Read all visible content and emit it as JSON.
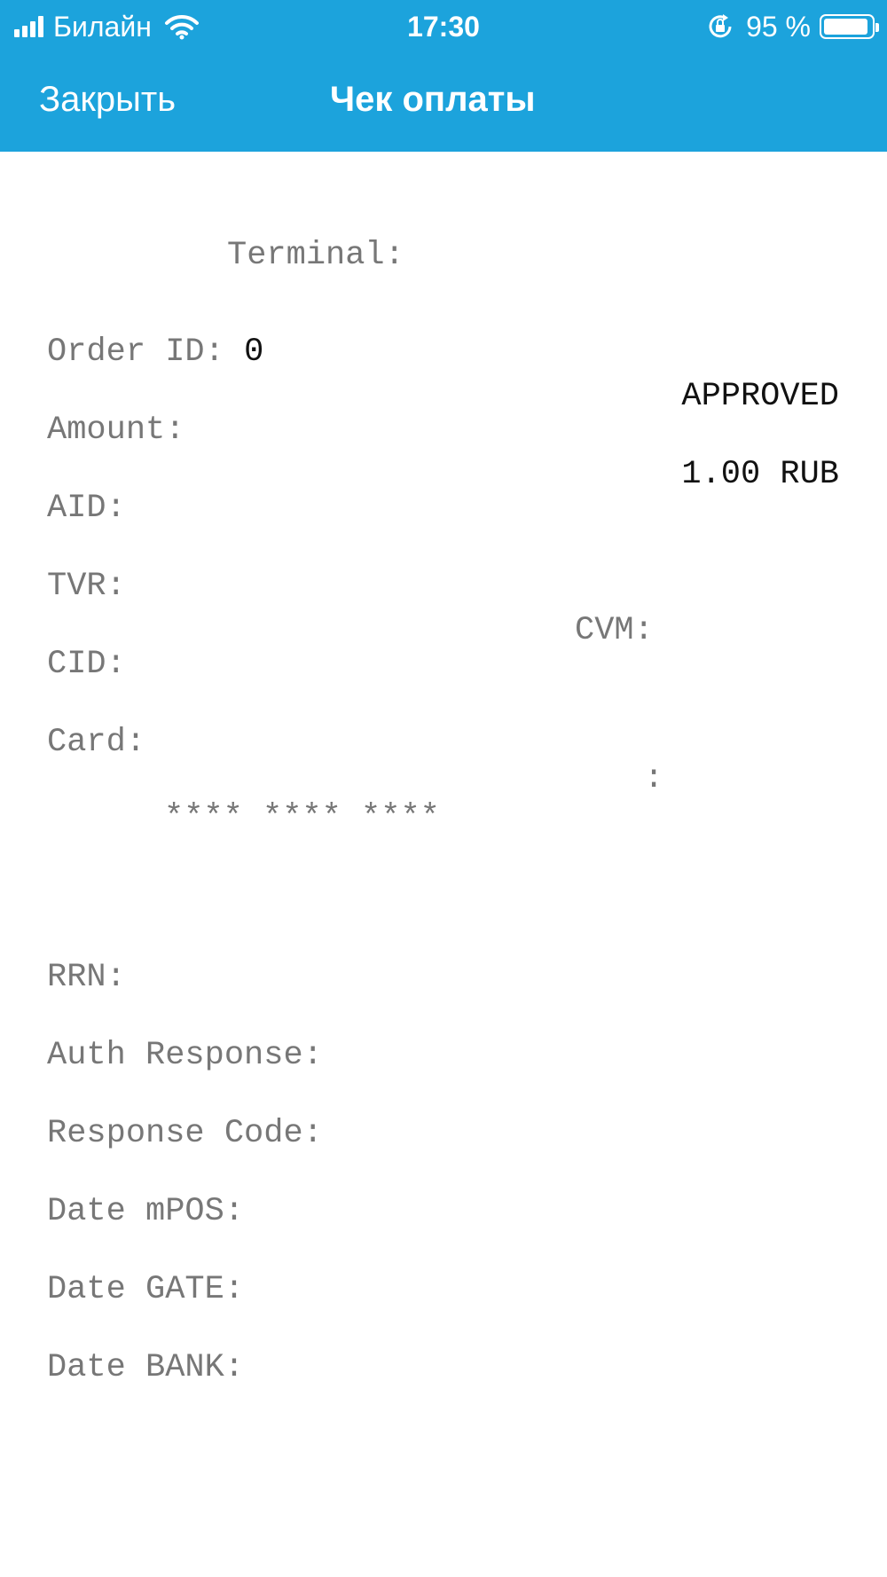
{
  "status_bar": {
    "carrier": "Билайн",
    "time": "17:30",
    "battery_percent": "95 %",
    "battery_level": 0.95,
    "icons": [
      "signal-icon",
      "wifi-icon",
      "orientation-lock-icon",
      "battery-icon"
    ]
  },
  "nav": {
    "close_label": "Закрыть",
    "title": "Чек оплаты"
  },
  "colors": {
    "accent": "#1ca3dc",
    "label_text": "#777777",
    "value_text": "#111111"
  },
  "receipt": {
    "terminal_label": "Terminal:",
    "order_id_label": "Order ID:",
    "order_id_value": "0",
    "status": "APPROVED",
    "amount_label": "Amount:",
    "amount_value": "1.00 RUB",
    "aid_label": "AID:",
    "tvr_label": "TVR:",
    "cvm_label": "CVM:",
    "cid_label": "CID:",
    "card_label": "Card:",
    "card_mask": "**** **** ****",
    "card_colon": ":",
    "rrn_label": "RRN:",
    "auth_response_label": "Auth Response:",
    "response_code_label": "Response Code:",
    "date_mpos_label": "Date mPOS:",
    "date_gate_label": "Date GATE:",
    "date_bank_label": "Date BANK:"
  }
}
